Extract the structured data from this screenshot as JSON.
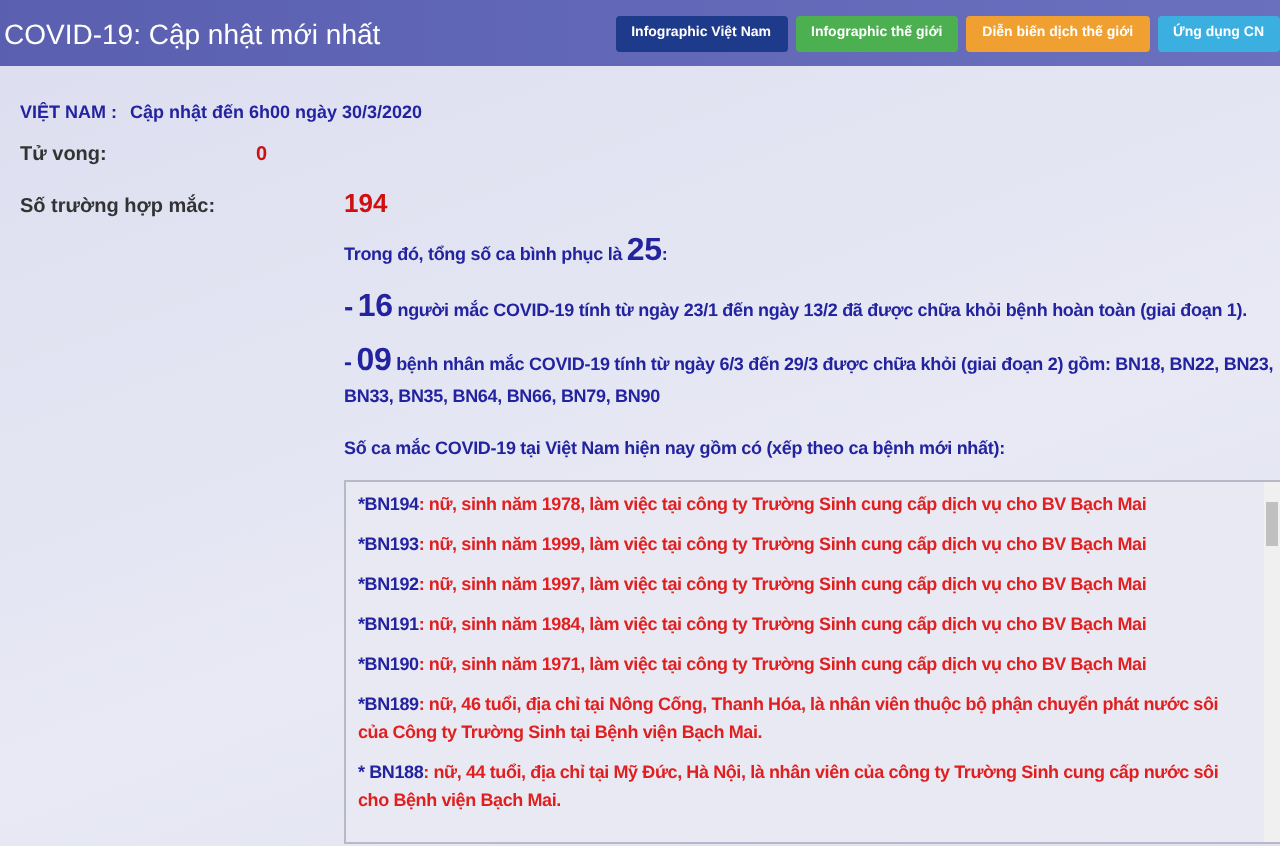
{
  "header": {
    "title": "COVID-19: Cập nhật mới nhất",
    "buttons": [
      {
        "label": "Infographic Việt Nam",
        "color": "#1e3a8a"
      },
      {
        "label": "Infographic thế giới",
        "color": "#4caf50"
      },
      {
        "label": "Diễn biến dịch thế giới",
        "color": "#f0a030"
      },
      {
        "label": "Ứng dụng CN",
        "color": "#3bb0e0"
      }
    ]
  },
  "update": {
    "label": "VIỆT NAM :",
    "text": "Cập nhật đến 6h00 ngày 30/3/2020"
  },
  "stats": [
    {
      "label": "Tử vong:",
      "value": "0"
    },
    {
      "label": "Số trường hợp mắc:",
      "value": "194"
    }
  ],
  "recovered": {
    "lead": "Trong đó, tổng số ca bình phục là",
    "number": "25",
    "tail": ":"
  },
  "phases": [
    {
      "prefix": "-",
      "number": "16",
      "text": "người mắc COVID-19 tính từ ngày 23/1 đến ngày 13/2 đã được chữa khỏi bệnh hoàn toàn (giai đoạn 1)."
    },
    {
      "prefix": "-",
      "number": "09",
      "text": "bệnh nhân mắc COVID-19 tính từ ngày 6/3 đến 29/3 được chữa khỏi (giai đoạn 2) gồm: BN18, BN22, BN23, BN33, BN35, BN64, BN66, BN79, BN90"
    }
  ],
  "list_title": "Số ca mắc COVID-19 tại Việt Nam hiện nay gồm có (xếp theo ca bệnh mới nhất):",
  "patients": [
    {
      "id": "*BN194",
      "text": ": nữ, sinh năm 1978,  làm việc tại công ty Trường Sinh cung cấp dịch vụ cho BV Bạch Mai"
    },
    {
      "id": "*BN193",
      "text": ": nữ, sinh năm 1999, làm việc tại công ty Trường Sinh cung cấp dịch vụ cho BV Bạch Mai"
    },
    {
      "id": "*BN192",
      "text": ": nữ, sinh năm 1997, làm việc tại công ty Trường Sinh cung cấp dịch vụ cho BV Bạch Mai"
    },
    {
      "id": "*BN191",
      "text": ": nữ, sinh năm 1984,  làm việc tại công ty Trường Sinh cung cấp dịch vụ cho BV Bạch Mai"
    },
    {
      "id": "*BN190",
      "text": ": nữ, sinh năm 1971,  làm việc tại công ty Trường Sinh cung cấp dịch vụ cho BV Bạch Mai"
    },
    {
      "id": "*BN189",
      "text": ": nữ, 46 tuổi, địa chỉ tại Nông Cống, Thanh Hóa, là nhân viên thuộc bộ phận chuyển phát nước sôi của Công ty Trường Sinh tại Bệnh viện Bạch Mai."
    },
    {
      "id": "* BN188",
      "text": ": nữ, 44 tuổi, địa chỉ tại Mỹ Đức, Hà Nội, là nhân viên của công ty Trường Sinh cung cấp nước sôi cho Bệnh viện Bạch Mai."
    }
  ]
}
